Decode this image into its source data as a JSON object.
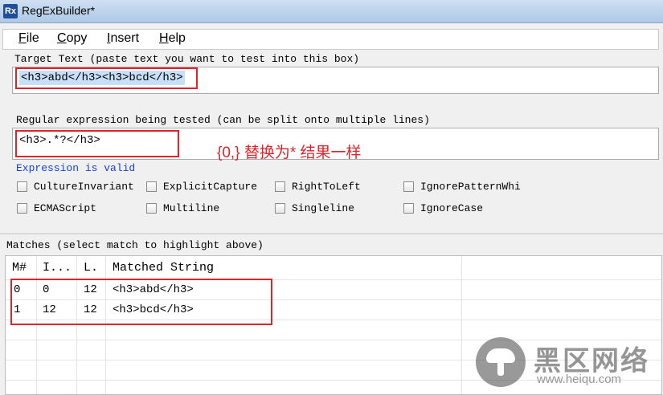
{
  "window": {
    "title": "RegExBuilder*",
    "icon": "Rx"
  },
  "menu": [
    {
      "key": "F",
      "rest": "ile"
    },
    {
      "key": "C",
      "rest": "opy"
    },
    {
      "key": "I",
      "rest": "nsert"
    },
    {
      "key": "H",
      "rest": "elp"
    }
  ],
  "target": {
    "label": "Target Text (paste text you want to test into this box)",
    "value": "<h3>abd</h3><h3>bcd</h3>"
  },
  "regex": {
    "label": "Regular expression being tested (can be split onto multiple lines)",
    "value": "<h3>.*?</h3>",
    "annotation": "{0,} 替换为* 结果一样",
    "status": "Expression is valid"
  },
  "options": [
    "CultureInvariant",
    "ExplicitCapture",
    "RightToLeft",
    "IgnorePatternWhi",
    "ECMAScript",
    "Multiline",
    "Singleline",
    "IgnoreCase"
  ],
  "matches": {
    "label": "Matches (select match to highlight above)",
    "columns": [
      "M#",
      "I...",
      "L.",
      "Matched String"
    ],
    "rows": [
      [
        "0",
        "0",
        "12",
        "<h3>abd</h3>"
      ],
      [
        "1",
        "12",
        "12",
        "<h3>bcd</h3>"
      ]
    ]
  },
  "watermark": {
    "name": "黑区网络",
    "url": "www.heiqu.com"
  },
  "colors": {
    "annotation": "#e0232b",
    "valid": "#1a3fd6",
    "selection": "#c7dff7"
  }
}
